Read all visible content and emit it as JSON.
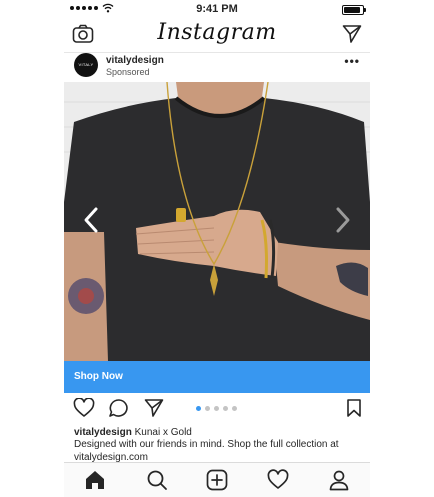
{
  "status_bar": {
    "time": "9:41 PM"
  },
  "top_nav": {
    "logo": "Instagram"
  },
  "post": {
    "avatar_text": "VITALY",
    "username": "vitalydesign",
    "sponsored": "Sponsored",
    "more": "•••",
    "cta": "Shop Now",
    "carousel": {
      "total": 5,
      "active_index": 0
    },
    "caption": {
      "username": "vitalydesign",
      "title": "Kunai x Gold",
      "description": "Designed with our friends in mind. Shop the full collection at vitalydesign.com"
    }
  },
  "colors": {
    "accent": "#3897f0",
    "text": "#262626"
  },
  "icons": [
    "camera-icon",
    "send-icon",
    "more-icon",
    "chevron-left-icon",
    "chevron-right-icon",
    "heart-icon",
    "comment-icon",
    "share-icon",
    "bookmark-icon",
    "home-icon",
    "search-icon",
    "add-icon",
    "activity-icon",
    "profile-icon"
  ]
}
